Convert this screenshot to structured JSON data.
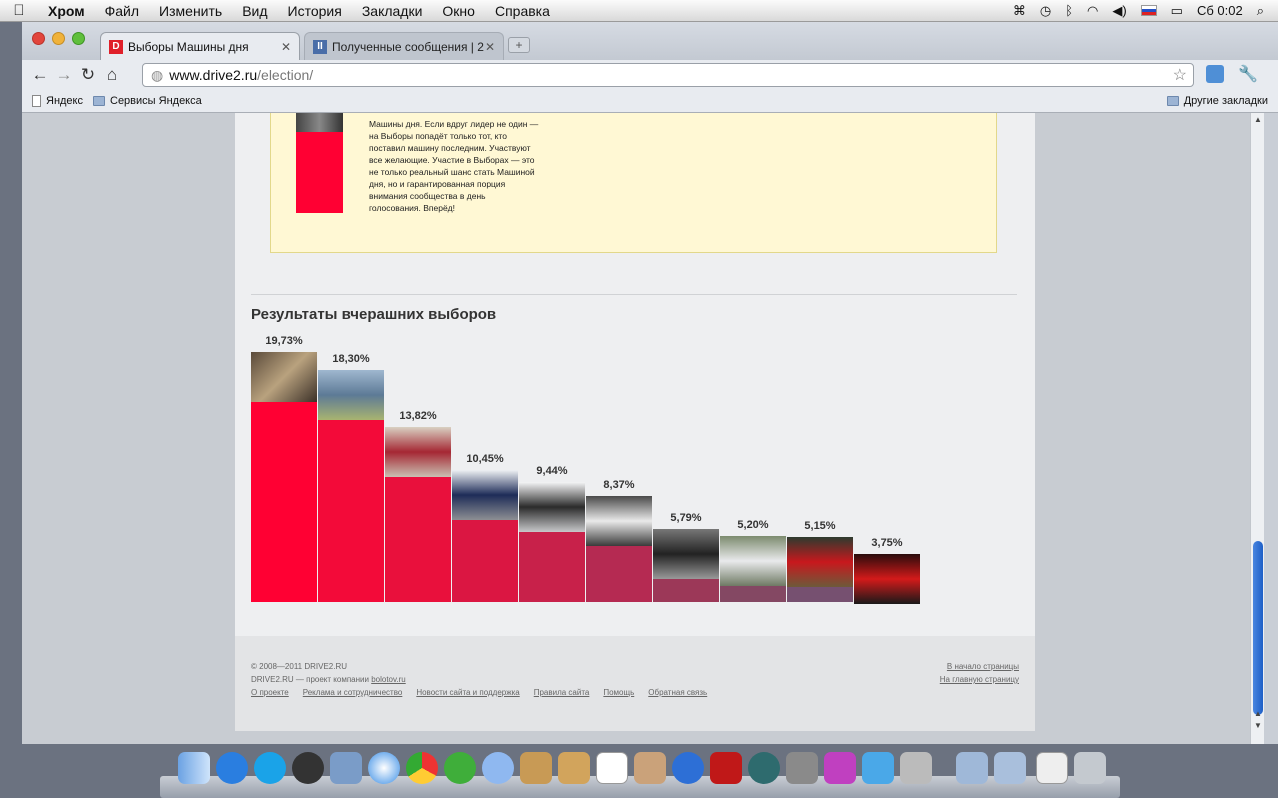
{
  "menubar": {
    "app": "Хром",
    "items": [
      "Файл",
      "Изменить",
      "Вид",
      "История",
      "Закладки",
      "Окно",
      "Справка"
    ],
    "clock": "Сб 0:02"
  },
  "tabs": [
    {
      "title": "Выборы Машины дня",
      "favicon": "D",
      "favicon_color": "#e0202a"
    },
    {
      "title": "Полученные сообщения | 2",
      "favicon": "II",
      "favicon_color": "#4a6ea8"
    }
  ],
  "address": {
    "host": "www.drive2.ru",
    "path": "/election/"
  },
  "bookmarks": {
    "items": [
      "Яндекс",
      "Сервисы Яндекса"
    ],
    "other": "Другие закладки"
  },
  "notice_text": "Машины дня. Если вдруг лидер не один — на Выборы попадёт только тот, кто поставил машину последним. Участвуют все желающие. Участие в Выборах — это не только реальный шанс стать Машиной дня, но и гарантированная порция внимания сообщества в день голосования. Вперёд!",
  "results": {
    "title": "Результаты вчерашних выборов"
  },
  "chart_data": {
    "type": "bar",
    "title": "Результаты вчерашних выборов",
    "categories": [
      "1",
      "2",
      "3",
      "4",
      "5",
      "6",
      "7",
      "8",
      "9",
      "10"
    ],
    "values": [
      19.73,
      18.3,
      13.82,
      10.45,
      9.44,
      8.37,
      5.79,
      5.2,
      5.15,
      3.75
    ],
    "labels": [
      "19,73%",
      "18,30%",
      "13,82%",
      "10,45%",
      "9,44%",
      "8,37%",
      "5,79%",
      "5,20%",
      "5,15%",
      "3,75%"
    ],
    "colors": [
      "#ff0033",
      "#f30a39",
      "#e9103c",
      "#db1642",
      "#c8214a",
      "#b52a52",
      "#9c3858",
      "#844863",
      "#765070",
      "#645979"
    ],
    "ylim": [
      0,
      19.73
    ],
    "grid": false
  },
  "footer": {
    "copyright": "© 2008—2011 DRIVE2.RU",
    "project": "DRIVE2.RU — проект компании",
    "company": "bolotov.ru",
    "links": [
      "О проекте",
      "Реклама и сотрудничество",
      "Новости сайта и поддержка",
      "Правила сайта",
      "Помощь",
      "Обратная связь"
    ],
    "to_top": "В начало страницы",
    "to_home": "На главную страницу"
  }
}
